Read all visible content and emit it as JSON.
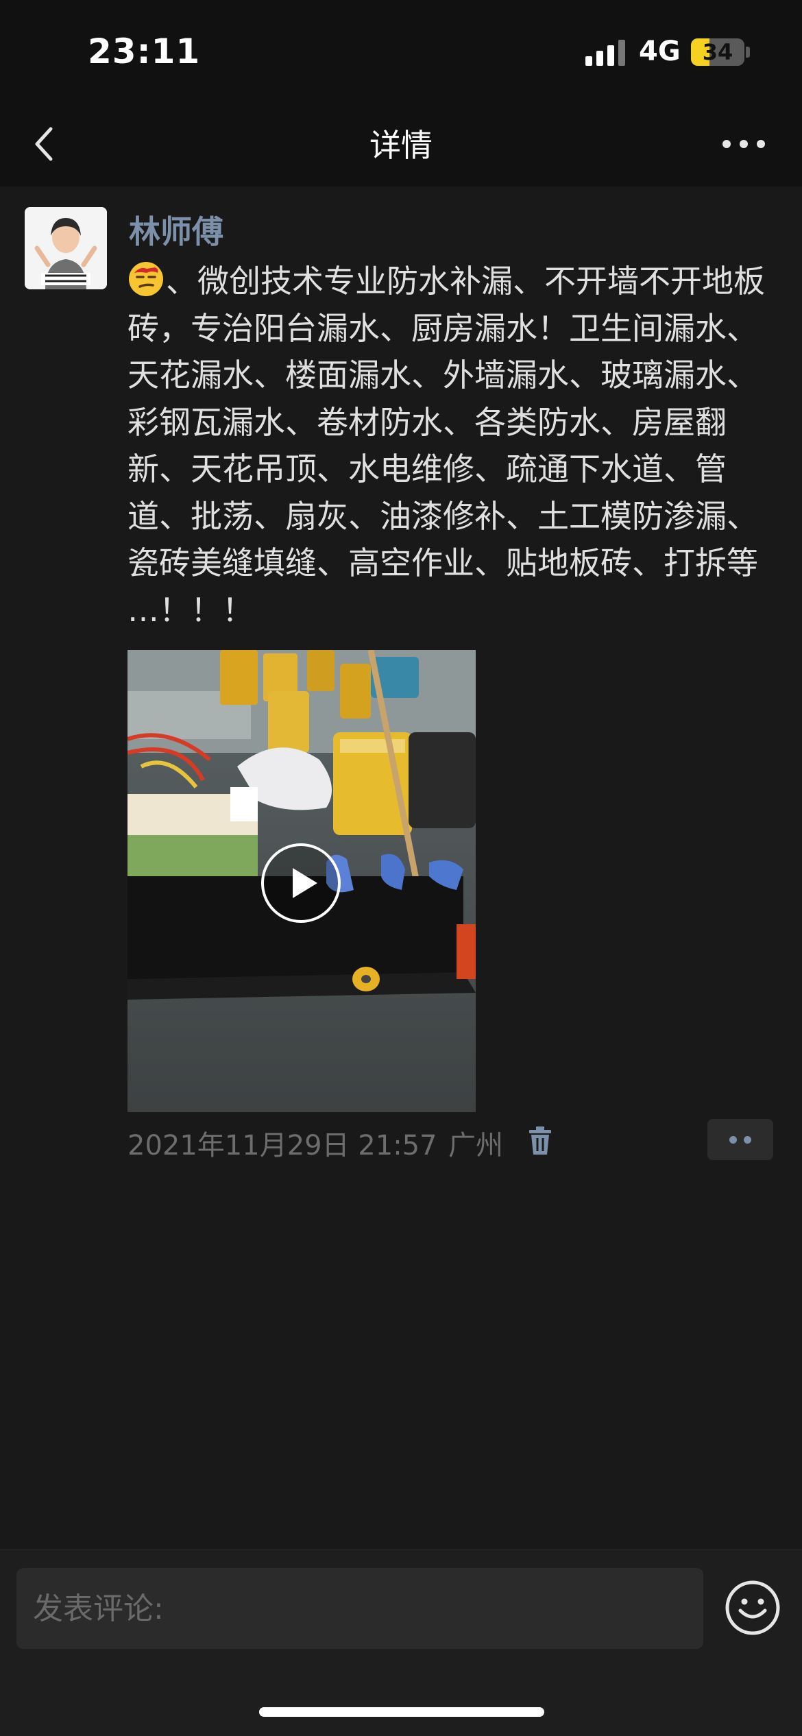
{
  "status_bar": {
    "time": "23:11",
    "network": "4G",
    "battery": "34",
    "battery_level_percent": 34
  },
  "nav": {
    "title": "详情",
    "back_icon": "chevron-left-icon",
    "more_icon": "ellipsis-icon"
  },
  "post": {
    "author": "林师傅",
    "emoji_icon": "smirking-face-emoji",
    "text": "、微创技术专业防水补漏、不开墙不开地板砖，专治阳台漏水、厨房漏水！卫生间漏水、天花漏水、楼面漏水、外墙漏水、玻璃漏水、彩钢瓦漏水、卷材防水、各类防水、房屋翻新、天花吊顶、水电维修、疏通下水道、管道、批荡、扇灰、油漆修补、土工模防渗漏、瓷砖美缝填缝、高空作业、贴地板砖、打拆等 …！！！",
    "video": {
      "play_icon": "play-icon"
    },
    "time": "2021年11月29日 21:57",
    "location": "广州",
    "delete_icon": "trash-icon",
    "action_icon": "two-dots-icon"
  },
  "comment": {
    "placeholder": "发表评论:",
    "emoji_icon": "smiley-icon"
  },
  "colors": {
    "background": "#191919",
    "bar": "#111111",
    "author": "#7d90a9",
    "meta": "#6d6d6d",
    "battery": "#f5d21f"
  }
}
